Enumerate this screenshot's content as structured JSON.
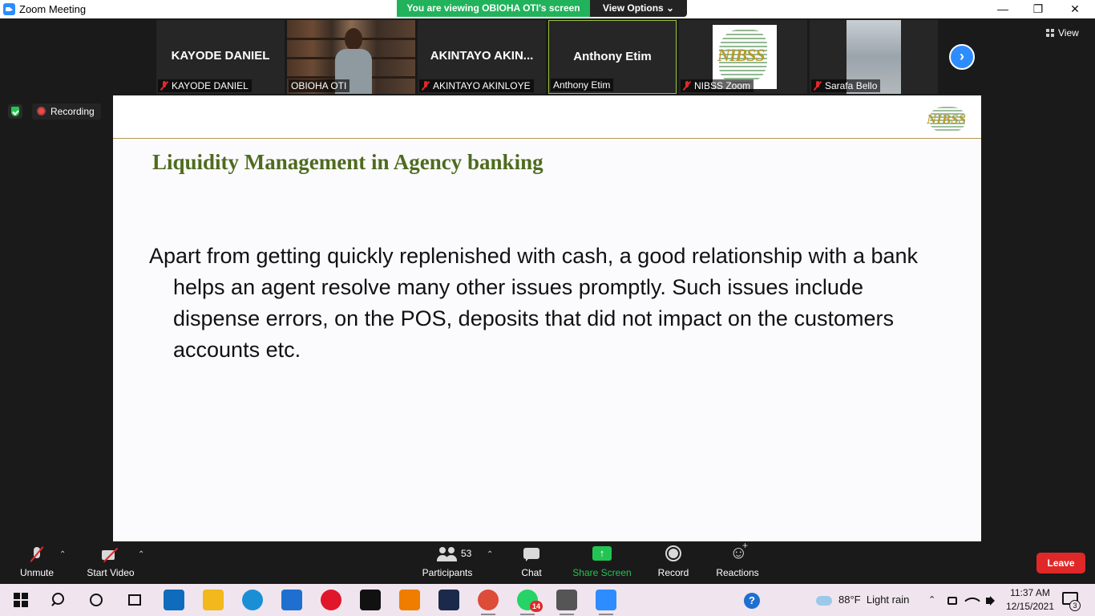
{
  "window": {
    "title": "Zoom Meeting",
    "controls": {
      "minimize": "—",
      "restore": "❐",
      "close": "✕"
    }
  },
  "banner": {
    "viewing": "You are viewing OBIOHA OTI's screen",
    "view_options": "View Options ⌄"
  },
  "thumbnails": [
    {
      "big_name": "KAYODE DANIEL",
      "label": "KAYODE DANIEL",
      "muted": true
    },
    {
      "big_name": "",
      "label": "OBIOHA OTI",
      "muted": false
    },
    {
      "big_name": "AKINTAYO AKIN...",
      "label": "AKINTAYO AKINLOYE",
      "muted": true
    },
    {
      "big_name": "Anthony Etim",
      "label": "Anthony Etim",
      "muted": false
    },
    {
      "big_name": "",
      "label": "NIBSS Zoom",
      "muted": true
    },
    {
      "big_name": "",
      "label": "Sarafa Bello",
      "muted": true
    }
  ],
  "strip": {
    "next": "›",
    "view": "View"
  },
  "status": {
    "recording": "Recording"
  },
  "slide": {
    "logo_text": "NIBSS",
    "heading": "Liquidity Management in Agency banking",
    "body": "Apart from getting quickly replenished with cash, a good relationship with a bank helps an agent resolve many other issues promptly. Such issues include dispense errors, on the POS, deposits that did not impact on the customers accounts etc."
  },
  "toolbar": {
    "unmute": "Unmute",
    "start_video": "Start Video",
    "participants": "Participants",
    "participants_count": "53",
    "chat": "Chat",
    "share_screen": "Share Screen",
    "record": "Record",
    "reactions": "Reactions",
    "leave": "Leave",
    "caret": "⌃"
  },
  "taskbar": {
    "apps": [
      {
        "name": "microsoft-store",
        "color": "#0f6cbd"
      },
      {
        "name": "file-explorer",
        "color": "#f2b81c"
      },
      {
        "name": "edge",
        "color": "#1a8fd6"
      },
      {
        "name": "mail",
        "color": "#1e6fd0"
      },
      {
        "name": "opera",
        "color": "#e0162b"
      },
      {
        "name": "dropbox",
        "color": "#111111"
      },
      {
        "name": "vlc",
        "color": "#ef7d00"
      },
      {
        "name": "visual-studio",
        "color": "#1b2a4a"
      },
      {
        "name": "chrome",
        "color": "#dd4b39"
      },
      {
        "name": "whatsapp",
        "color": "#25d366",
        "badge": "14"
      },
      {
        "name": "settings",
        "color": "#555555"
      },
      {
        "name": "zoom",
        "color": "#2d8cff"
      }
    ],
    "weather_temp": "88°F",
    "weather_desc": "Light rain",
    "time": "11:37 AM",
    "date": "12/15/2021",
    "notifications": "3",
    "tray_caret": "⌃"
  }
}
